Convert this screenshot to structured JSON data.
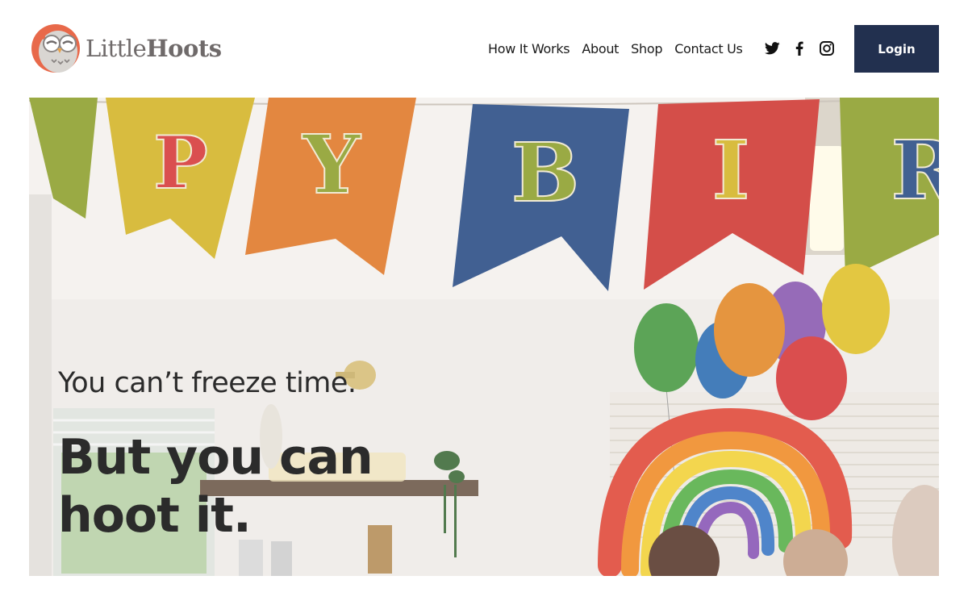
{
  "brand": {
    "name_light": "Little",
    "name_bold": "Hoots",
    "logo_icon": "owl-logo-icon"
  },
  "nav": {
    "items": [
      {
        "label": "How It Works"
      },
      {
        "label": "About"
      },
      {
        "label": "Shop"
      },
      {
        "label": "Contact Us"
      }
    ]
  },
  "social": [
    "twitter-icon",
    "facebook-icon",
    "instagram-icon"
  ],
  "header": {
    "login_label": "Login"
  },
  "hero": {
    "subtitle": "You can’t freeze time.",
    "title_line1": "But you can",
    "title_line2": "hoot it.",
    "banner_letters": [
      "P",
      "Y",
      "B",
      "I",
      "R"
    ]
  },
  "colors": {
    "login_bg": "#22304f",
    "text_dark": "#2b2b2b",
    "logo_text": "#6f6a6a",
    "owl_orange": "#e8694a"
  }
}
